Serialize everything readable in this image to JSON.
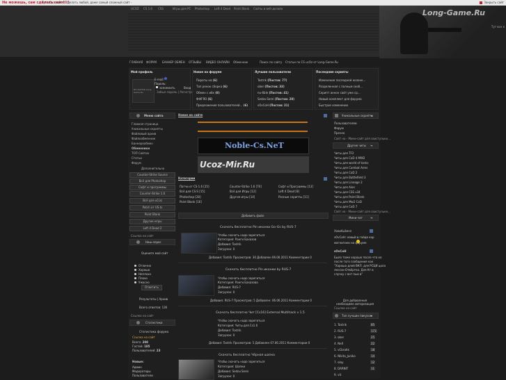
{
  "ticker": {
    "alert": "Не можешь, сам сделать сайт!!!!",
    "message": "Тут uCoz можно сделать любой, даже самый сложный сайт -",
    "close": "Закрыть сайт"
  },
  "top_nav": [
    "UCOZ",
    "CS 1.6",
    "CSS",
    "Игры для PC",
    "Photoshop",
    "Left 4 Dead",
    "Point Blank",
    "Сайты и веб-дизайн"
  ],
  "header": {
    "logo": "Long-Game.Ru",
    "side_text": "Тут все к"
  },
  "main_nav": [
    "ГЛАВНАЯ",
    "ФОРУМ",
    "БАННЕР ОБМЕН",
    "ОТЗЫВЫ",
    "ВИДЕО ОНЛАЙН",
    "Обменник",
    "Поиск по сайту",
    "Статьи по CS ucOz от Long-Game.Ru"
  ],
  "profile": {
    "title": "Мой профиль",
    "avatar_text": "NO AVATAR Long-Game.Ru",
    "email_label": "E-mail:",
    "password_label": "Пароль:",
    "remember_label": "запомнить",
    "login_button": "Вход",
    "forgot": "Забыл пароль | Регистрация"
  },
  "forum_new": {
    "title": "Новое на форуме",
    "items": [
      {
        "name": "Пираты на",
        "count": "(6)"
      },
      {
        "name": "Топ ренок сборка",
        "count": "(6)"
      },
      {
        "name": "Обмен с ибк",
        "count": "(8)"
      },
      {
        "name": "ФФГЯО",
        "count": "(6)"
      },
      {
        "name": "Предложения пользователей...",
        "count": "(6)"
      }
    ]
  },
  "best_users": {
    "title": "Лучшие пользователи",
    "items": [
      {
        "name": "Tostrik",
        "posts": "(Постов: 77)"
      },
      {
        "name": "ober",
        "posts": "(Постов: 33)"
      },
      {
        "name": "nu-6ble",
        "posts": "(Постов: 41)"
      },
      {
        "name": "Sedov.Serei",
        "posts": "(Постов: 28)"
      },
      {
        "name": "sOvCoH",
        "posts": "(Постов: 21)"
      }
    ]
  },
  "latest_scripts": {
    "title": "Последние скрипты",
    "items": [
      "Изменение последней колонк...",
      "Разделенная с полным скоб...",
      "Скрипт аннон сайт уже ср...",
      "Новый комплект для форума",
      "Быстрое изменение"
    ]
  },
  "left_menu": {
    "title": "Меню сайта",
    "items": [
      "Главная страница",
      "Уникальные скрипты",
      "Файловый архив",
      "Файлообменник",
      "Баннерообмен",
      "Обменники",
      "ТОП Сайтов",
      "Статьи",
      "Форум"
    ],
    "active": "Обменники",
    "sub_title": "Дополнительно",
    "sub_items": [
      "Counter-Strike Source",
      "Всё для Photoshop",
      "Софт и программы",
      "Counter-Strike 1.6",
      "Всё для uCoz",
      "Patch от US.ts",
      "Point Blank",
      "Другие игры",
      "Left 4 Dead 2"
    ],
    "link": "Ссылка на сайт"
  },
  "poll": {
    "title": "Наш опрос",
    "question": "Оцените мой сайт",
    "options": [
      "Отлично",
      "Хорошо",
      "Неплохо",
      "Плохо",
      "Ужасно"
    ],
    "vote_button": "Ответить",
    "results": "Результаты | Архив",
    "total": "Всего ответов: 136"
  },
  "stats": {
    "title": "Статистика",
    "sub": "Статистика форума",
    "online_label": "Всего:",
    "online": "208",
    "guests_label": "Гостей:",
    "guests": "185",
    "users_label": "Пользователей:",
    "users": "23",
    "new_title": "Новые:",
    "new_items": [
      "Админ",
      "Модераторы",
      "Пользователи"
    ]
  },
  "center": {
    "news_title": "Новое на сайте",
    "banner1": "Noble-Cs.NeT",
    "banner2": "Ucoz-Mir.Ru",
    "categories_title": "Категории",
    "categories": [
      [
        "Патчи от CS 1.6 [25]",
        "Counter-Strike 1.6 [70]",
        "Софт и Программы [13]"
      ],
      [
        "Всё для CS:S [15]",
        "Всё для Игры [12]",
        "Left 4 Dead [8]"
      ],
      [
        "Photoshop [28]",
        "Другие игры [14]",
        "Разные скрипты [11]"
      ],
      [
        "Point Blank [16]",
        "",
        ""
      ]
    ],
    "add_file": "Добавить файл",
    "files": [
      {
        "title": "Скачать бесплатно Pin иконки Go-Gs by RUS-7",
        "lines": [
          "Чтобы скачать надо зарегиться",
          "Категория: Ранги Бахазов",
          "Добавил: Tostrik",
          "Загрузок: 0"
        ],
        "meta": "Добавил: Tostrik Просмотров: 30 Добавлен 06.06.2011 Комментарии 0"
      },
      {
        "title": "Скачать бесплатно Pin иконки by RUS-7",
        "lines": [
          "Чтобы скачать надо зарегиться",
          "Категория: Ранги Бахазова",
          "Добавил: RUS-7",
          "Загрузок: 0"
        ],
        "meta": "Добавил: RUS-7 Просмотров: 5 Добавлен: 06.06.2011 Комментарии 0"
      },
      {
        "title": "Скачать бесплатно Чит [Cs16] External Multihack v 1.5",
        "lines": [
          "Чтобы скачать надо зарегиться",
          "Категория: Читы для Cs1.6",
          "Добавил: Tostrik",
          "Загрузок: 0"
        ],
        "meta": "Добавил: Tostrik Просмотров: 5 Добавлен 07.06.2011 Комментарии 0"
      },
      {
        "title": "Скачать бесплатно Чёрная шапка",
        "lines": [
          "Чтобы скачать надо зарегиться",
          "Категория: Шапки",
          "Добавил: Sedov.Serei",
          "Загрузок: 0"
        ],
        "meta": ""
      }
    ]
  },
  "right": {
    "scripts_title": "Уникальные скрипты",
    "scripts_items": [
      "Пользователям",
      "Форум",
      "Прочее",
      "Сайты всем",
      "Сайт на - Мини-сайт для свистульки..."
    ],
    "more": "Другие читы",
    "cheats": [
      "Читы для TF2",
      "Читы для CoD 4 MW2",
      "Читы для world of tanks",
      "Читы для Combat Arms",
      "Читы для CoD 2",
      "Читы для Battlefield 3",
      "Читы для Lineage 2",
      "Читы для Aion",
      "Читы для CSS v34",
      "Читы для Point Blank",
      "Читы для Mw2 CoD",
      "Читы для CoD 7",
      "Сайт на - Мини-сайт для свистульки..."
    ],
    "mini_title": "Мини-чат",
    "mini_sub": "Ховобьёмнn",
    "mini_text": [
      "sOvCoH: новый в гайде кор",
      "магнитики на форуме"
    ],
    "shout_title": "sOvCoH",
    "shout_text": [
      "Было тоже хорошо после что на",
      "после того сообщения как",
      "\"Хорошо длей ВКЛ. для РСЦИ цола",
      "лессон-Отвёртка. Для Кт в",
      "случку с вот пью в\""
    ],
    "top_title": "Топ лучших пикусов",
    "top_note": "Для добавления необходимо авторизация",
    "top": [
      {
        "rank": "1.",
        "name": "Tostrik",
        "score": "85"
      },
      {
        "rank": "2.",
        "name": "RUS-7",
        "score": "173"
      },
      {
        "rank": "3.",
        "name": "ober",
        "score": "25"
      },
      {
        "rank": "4.",
        "name": "NeX",
        "score": "22"
      },
      {
        "rank": "5.",
        "name": "vCbrahk",
        "score": "18"
      },
      {
        "rank": "6.",
        "name": "Nikita_Juniko",
        "score": "14"
      },
      {
        "rank": "7.",
        "name": "olay",
        "score": "12"
      },
      {
        "rank": "8.",
        "name": "DARNIT",
        "score": "11"
      },
      {
        "rank": "9.",
        "name": "vit",
        " score": "11"
      }
    ]
  }
}
